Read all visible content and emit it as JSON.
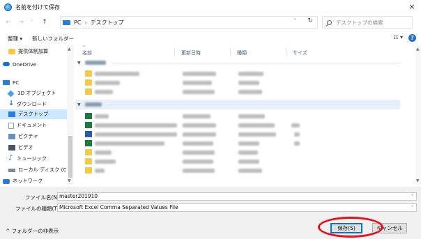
{
  "window": {
    "title": "名前を付けて保存",
    "close_glyph": "×",
    "icon": "save-app-icon"
  },
  "address": {
    "back_glyph": "←",
    "forward_glyph": "→",
    "recent_glyph": "˅",
    "up_glyph": "↑",
    "crumbs": [
      "PC",
      "デスクトップ"
    ],
    "separator": "›",
    "dropdown_glyph": "˅",
    "refresh_glyph": "↻",
    "search_placeholder": "デスクトップの検索"
  },
  "toolbar": {
    "organize": "整理 ▾",
    "new_folder": "新しいフォルダー",
    "view_glyph": "☷ ▾",
    "help_glyph": "?"
  },
  "nav": {
    "items": [
      {
        "label": "提供体制加算",
        "icon": "folder-icon"
      },
      {
        "label": "OneDrive",
        "icon": "onedrive-icon"
      },
      {
        "label": "PC",
        "icon": "pc-icon"
      },
      {
        "label": "3D オブジェクト",
        "icon": "3d-objects-icon"
      },
      {
        "label": "ダウンロード",
        "icon": "download-icon"
      },
      {
        "label": "デスクトップ",
        "icon": "desktop-icon"
      },
      {
        "label": "ドキュメント",
        "icon": "documents-icon"
      },
      {
        "label": "ピクチャ",
        "icon": "pictures-icon"
      },
      {
        "label": "ビデオ",
        "icon": "videos-icon"
      },
      {
        "label": "ミュージック",
        "icon": "music-icon"
      },
      {
        "label": "ローカル ディスク (C",
        "icon": "local-disk-icon"
      },
      {
        "label": "ネットワーク",
        "icon": "network-icon"
      }
    ],
    "selected_index": 5,
    "scroll_up": "▲",
    "scroll_down": "▼"
  },
  "columns": {
    "name": "名前",
    "modified": "更新日時",
    "type": "種類",
    "size": "サイズ",
    "sort_glyph": "^"
  },
  "main_scroll": {
    "up": "▲",
    "down": "▼"
  },
  "save_form": {
    "filename_label": "ファイル名(N):",
    "filename_value": "master201910",
    "filetype_label": "ファイルの種類(T):",
    "filetype_value": "Microsoft Excel Comma Separated Values File",
    "dropdown_glyph": "˅",
    "hide_folders": "^ フォルダーの非表示",
    "save_button": "保存(S)",
    "cancel_button": "キャンセル"
  },
  "colors": {
    "selection": "#cce8ff",
    "accent": "#0078d7",
    "highlight_circle": "#e8101a"
  }
}
